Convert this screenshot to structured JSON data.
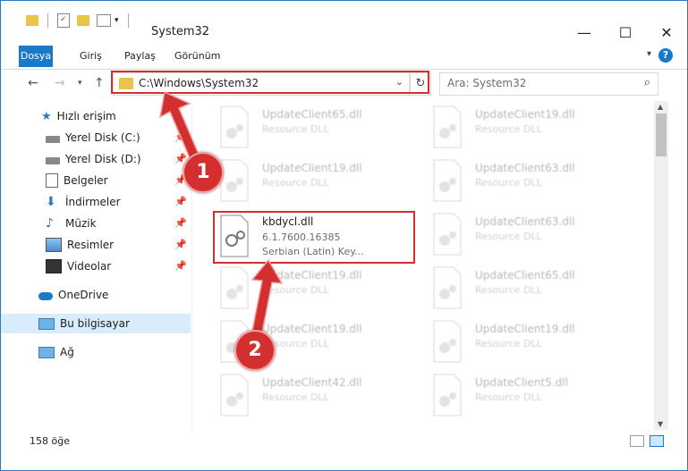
{
  "window": {
    "title": "System32",
    "controls": [
      "—",
      "☐",
      "✕"
    ]
  },
  "ribbon": {
    "tabs": [
      {
        "label": "Dosya"
      },
      {
        "label": "Giriş"
      },
      {
        "label": "Paylaş"
      },
      {
        "label": "Görünüm"
      }
    ],
    "help_label": "?"
  },
  "address_bar": {
    "path": "C:\\Windows\\System32"
  },
  "search": {
    "placeholder": "Ara: System32"
  },
  "nav_pane": {
    "items": [
      {
        "label": "Hızlı erişim",
        "icon": "star-icon"
      },
      {
        "label": "Yerel Disk (C:)",
        "icon": "drive-icon"
      },
      {
        "label": "Yerel Disk (D:)",
        "icon": "drive-icon"
      },
      {
        "label": "Belgeler",
        "icon": "documents-icon"
      },
      {
        "label": "İndirmeler",
        "icon": "downloads-icon"
      },
      {
        "label": "Müzik",
        "icon": "music-icon"
      },
      {
        "label": "Resimler",
        "icon": "pictures-icon"
      },
      {
        "label": "Videolar",
        "icon": "videos-icon"
      },
      {
        "label": "OneDrive",
        "icon": "cloud-icon"
      },
      {
        "label": "Bu bilgisayar",
        "icon": "computer-icon"
      },
      {
        "label": "Ağ",
        "icon": "network-icon"
      }
    ]
  },
  "files": {
    "left": [
      {
        "name": "UpdateClient65.dll",
        "type": "Resource DLL"
      },
      {
        "name": "UpdateClient19.dll",
        "type": "Resource DLL"
      },
      {
        "name": "kbdycl.dll",
        "type": "6.1.7600.16385",
        "desc": "Serbian (Latin) Key..."
      },
      {
        "name": "UpdateClient19.dll",
        "type": "Resource DLL"
      },
      {
        "name": "UpdateClient19.dll",
        "type": "Resource DLL"
      },
      {
        "name": "UpdateClient42.dll",
        "type": "Resource DLL"
      }
    ],
    "right": [
      {
        "name": "UpdateClient19.dll",
        "type": "Resource DLL"
      },
      {
        "name": "UpdateClient63.dll",
        "type": "Resource DLL"
      },
      {
        "name": "UpdateClient63.dll",
        "type": "Resource DLL"
      },
      {
        "name": "UpdateClient65.dll",
        "type": "Resource DLL"
      },
      {
        "name": "UpdateClient19.dll",
        "type": "Resource DLL"
      },
      {
        "name": "UpdateClient5.dll",
        "type": "Resource DLL"
      }
    ]
  },
  "status": {
    "count": "158 öğe"
  },
  "annotations": {
    "step1": "1",
    "step2": "2",
    "color": "#d32f2f"
  }
}
